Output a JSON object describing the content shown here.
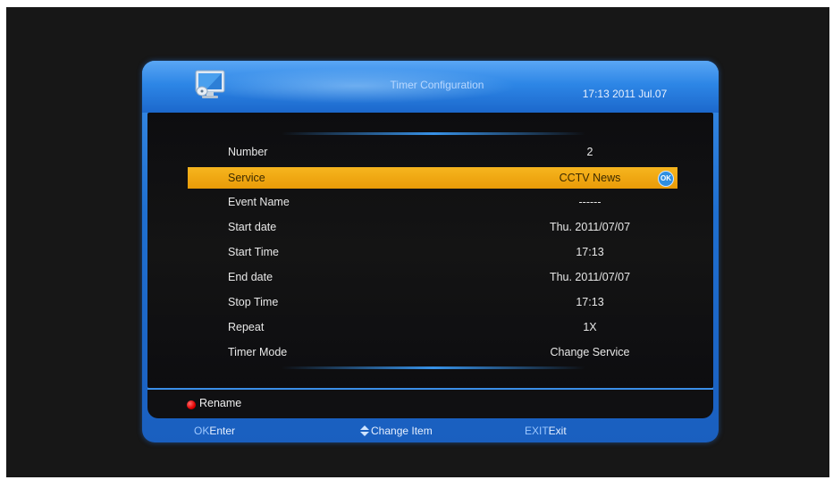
{
  "header": {
    "title": "Timer Configuration",
    "clock": "17:13 2011 Jul.07"
  },
  "rows": [
    {
      "label": "Number",
      "value": "2",
      "selected": false
    },
    {
      "label": "Service",
      "value": "CCTV News",
      "selected": true,
      "badge": "OK"
    },
    {
      "label": "Event Name",
      "value": "------",
      "selected": false
    },
    {
      "label": "Start date",
      "value": "Thu. 2011/07/07",
      "selected": false
    },
    {
      "label": "Start Time",
      "value": "17:13",
      "selected": false
    },
    {
      "label": "End date",
      "value": "Thu. 2011/07/07",
      "selected": false
    },
    {
      "label": "Stop Time",
      "value": "17:13",
      "selected": false
    },
    {
      "label": "Repeat",
      "value": "1X",
      "selected": false
    },
    {
      "label": "Timer Mode",
      "value": "Change Service",
      "selected": false
    }
  ],
  "footer": {
    "rename_label": "Rename"
  },
  "hints": {
    "ok_key": "OK",
    "ok_text": "Enter",
    "change_text": "Change Item",
    "exit_key": "EXIT",
    "exit_text": "Exit"
  },
  "colors": {
    "accent_blue": "#2d86e6",
    "highlight_orange": "#f0a812",
    "background": "#171717"
  },
  "icons": {
    "app": "monitor-satellite-icon",
    "red_button": "red-dot-icon",
    "up_down": "up-down-arrows-icon"
  }
}
